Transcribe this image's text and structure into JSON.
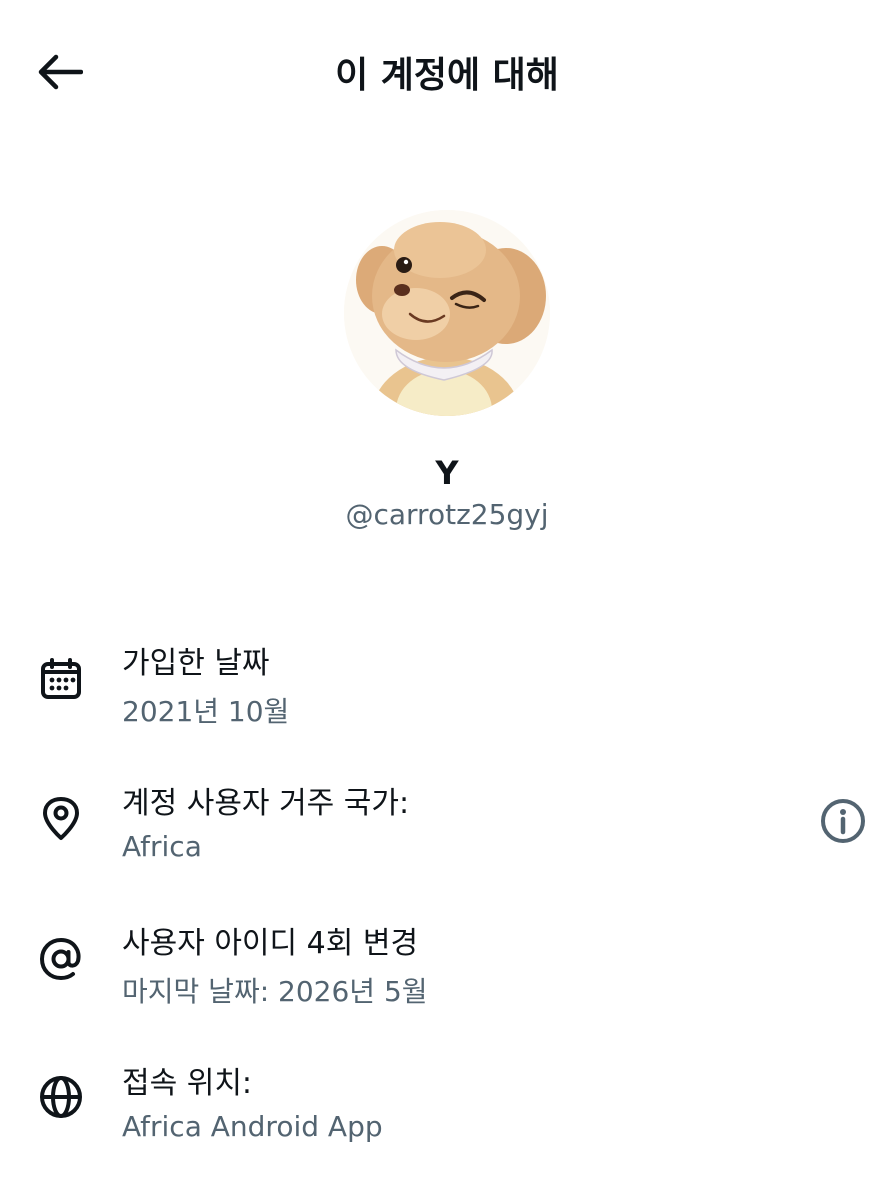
{
  "header": {
    "title": "이 계정에 대해",
    "back_icon": "arrow-left-icon"
  },
  "profile": {
    "display_name": "Y",
    "handle": "@carrotz25gyj",
    "avatar": "plush-puppy-avatar"
  },
  "info": {
    "joined": {
      "icon": "calendar-icon",
      "label": "가입한 날짜",
      "value": "2021년 10월"
    },
    "country": {
      "icon": "location-pin-icon",
      "label": "계정 사용자 거주 국가:",
      "value": "Africa",
      "help_icon": "info-icon"
    },
    "username_changes": {
      "icon": "at-sign-icon",
      "label": "사용자 아이디 4회 변경",
      "value": "마지막 날짜: 2026년 5월"
    },
    "connected_via": {
      "icon": "globe-icon",
      "label": "접속 위치:",
      "value": "Africa Android App"
    }
  },
  "colors": {
    "text_primary": "#0f1419",
    "text_secondary": "#536471",
    "background": "#ffffff"
  }
}
